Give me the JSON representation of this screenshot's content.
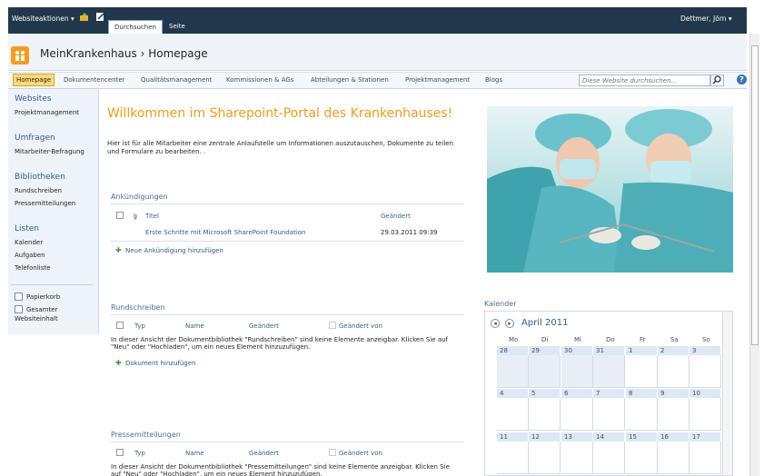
{
  "ribbon": {
    "site_actions": "Websiteaktionen ▾",
    "tabs": [
      "Durchsuchen",
      "Seite"
    ],
    "user": "Dettmer, Jörn ▾"
  },
  "site": {
    "title": "MeinKrankenhaus",
    "separator": "›",
    "page": "Homepage"
  },
  "topnav": {
    "items": [
      "Homepage",
      "Dokumentencenter",
      "Qualitätsmanagement",
      "Kommissionen & AGs",
      "Abteilungen & Stationen",
      "Projektmanagement",
      "Blogs"
    ],
    "search_placeholder": "Diese Website durchsuchen...",
    "help": "?"
  },
  "quicklaunch": {
    "sections": [
      {
        "heading": "Websites",
        "items": [
          "Projektmanagement"
        ]
      },
      {
        "heading": "Umfragen",
        "items": [
          "Mitarbeiter-Befragung"
        ]
      },
      {
        "heading": "Bibliotheken",
        "items": [
          "Rundschreiben",
          "Pressemitteilungen"
        ]
      },
      {
        "heading": "Listen",
        "items": [
          "Kalender",
          "Aufgaben",
          "Telefonliste"
        ]
      }
    ],
    "recycle": "Papierkorb",
    "all_content": [
      "Gesamter",
      "Websiteinhalt"
    ]
  },
  "main": {
    "welcome": "Willkommen im Sharepoint-Portal des Krankenhauses!",
    "intro": "Hier ist für alle Mitarbeiter eine zentrale Anlaufstelle um Informationen auszutauschen, Dokumente zu teilen und Formulare zu bearbeiten. ."
  },
  "announcements": {
    "title": "Ankündigungen",
    "col_title": "Titel",
    "col_changed": "Geändert",
    "rows": [
      {
        "title": "Erste Schritte mit Microsoft SharePoint Foundation",
        "changed": "29.03.2011 09:39"
      }
    ],
    "add": "Neue Ankündigung hinzufügen"
  },
  "rundschreiben": {
    "title": "Rundschreiben",
    "cols": [
      "Typ",
      "Name",
      "Geändert",
      "Geändert von"
    ],
    "empty": "In dieser Ansicht der Dokumentbibliothek \"Rundschreiben\" sind keine Elemente anzeigbar. Klicken Sie auf \"Neu\" oder \"Hochladen\", um ein neues Element hinzuzufügen.",
    "add": "Dokument hinzufügen"
  },
  "presse": {
    "title": "Pressemitteilungen",
    "cols": [
      "Typ",
      "Name",
      "Geändert",
      "Geändert von"
    ],
    "empty": "In dieser Ansicht der Dokumentbibliothek \"Pressemitteilungen\" sind keine Elemente anzeigbar. Klicken Sie auf \"Neu\" oder \"Hochladen\", um ein neues Element hinzuzufügen."
  },
  "calendar": {
    "title": "Kalender",
    "month": "April 2011",
    "days": [
      "Mo",
      "Di",
      "Mi",
      "Do",
      "Fr",
      "Sa",
      "So"
    ],
    "weeks": [
      [
        "28",
        "29",
        "30",
        "31",
        "1",
        "2",
        "3"
      ],
      [
        "4",
        "5",
        "6",
        "7",
        "8",
        "9",
        "10"
      ],
      [
        "11",
        "12",
        "13",
        "14",
        "15",
        "16",
        "17"
      ]
    ]
  }
}
